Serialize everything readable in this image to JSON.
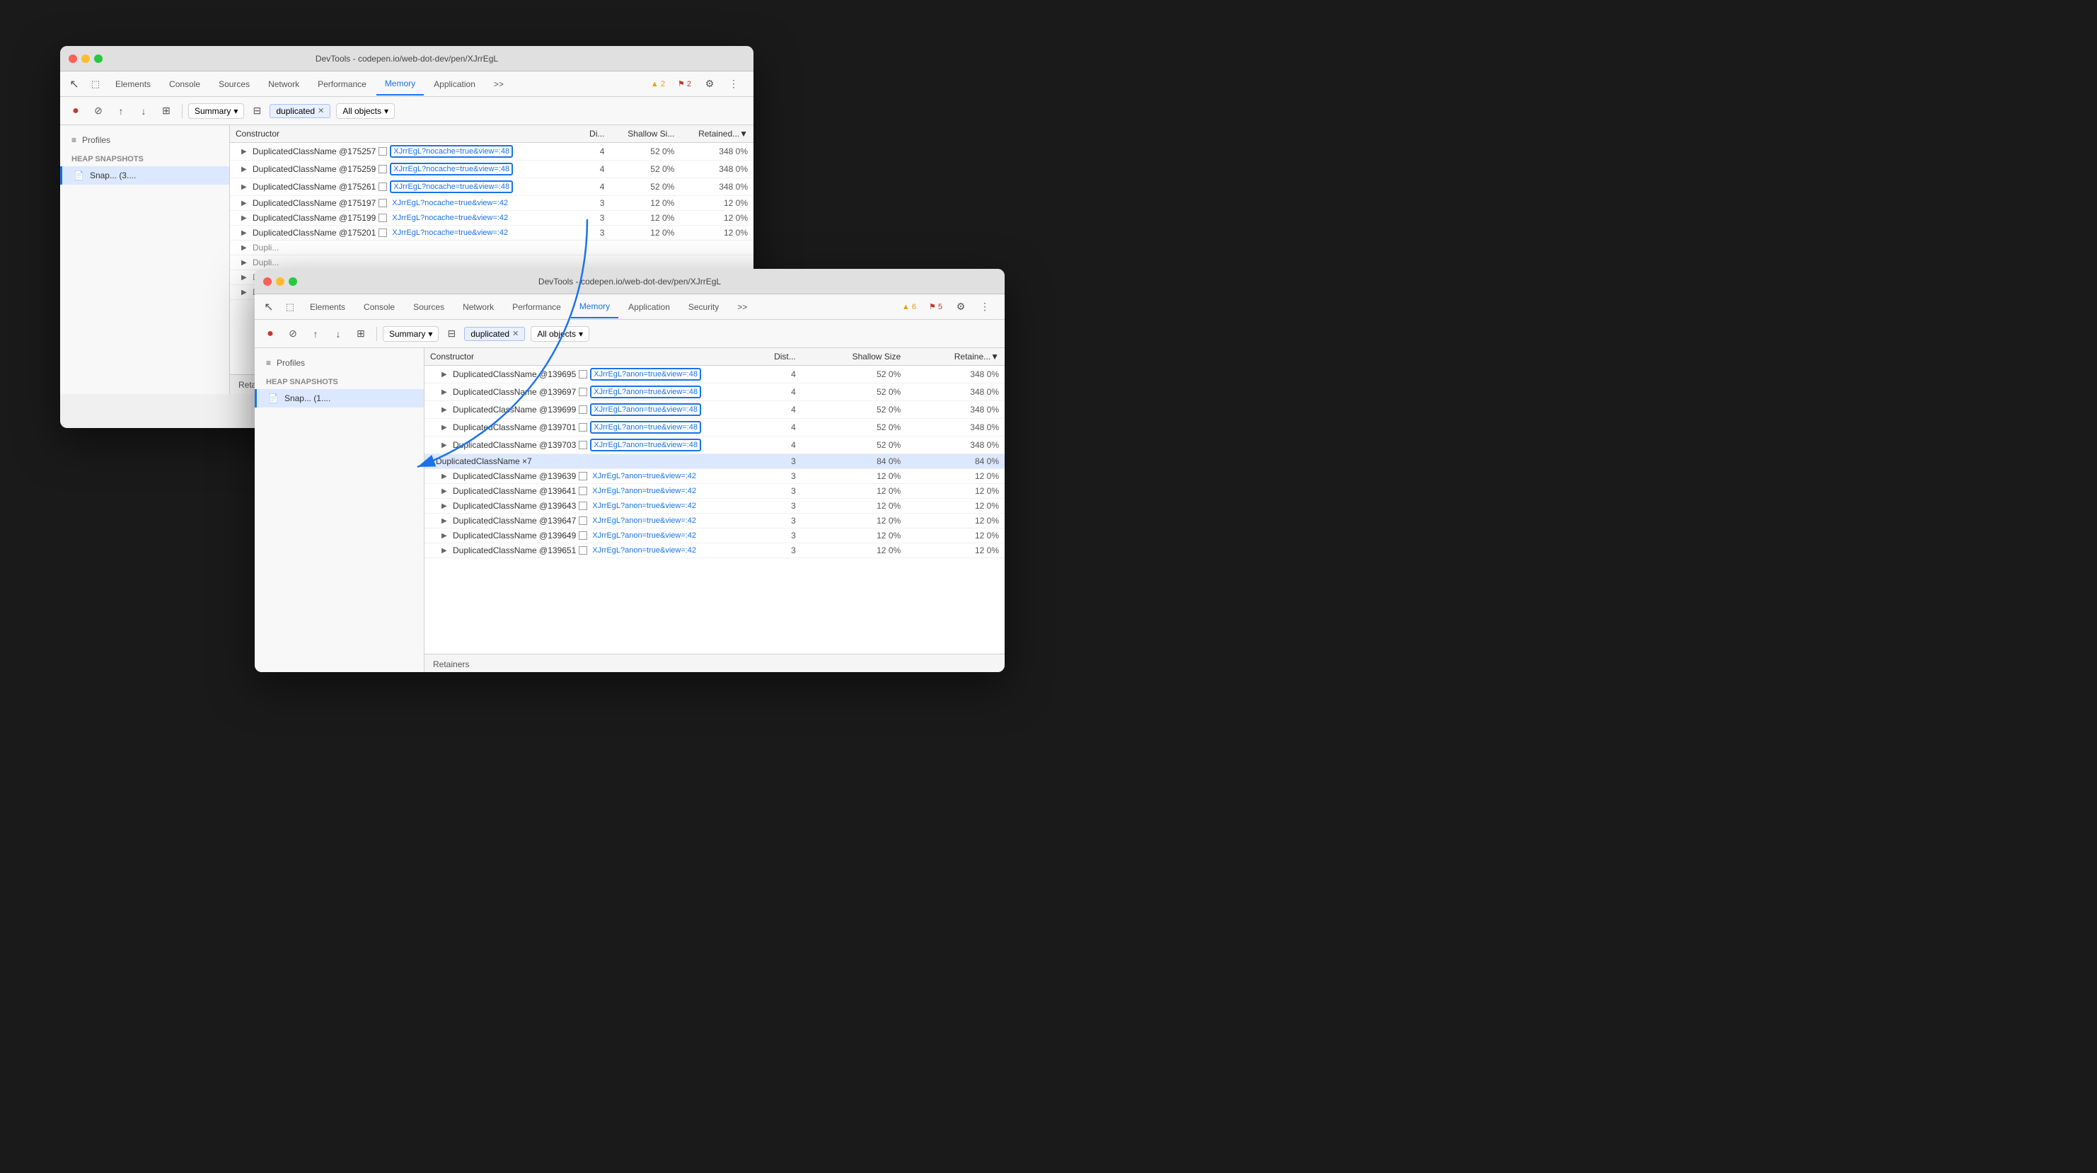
{
  "window1": {
    "title": "DevTools - codepen.io/web-dot-dev/pen/XJrrEgL",
    "tabs": [
      "Elements",
      "Console",
      "Sources",
      "Network",
      "Performance",
      "Memory",
      "Application",
      ">>"
    ],
    "active_tab": "Memory",
    "badges": [
      {
        "type": "warn",
        "count": "2"
      },
      {
        "type": "error",
        "count": "2"
      }
    ],
    "filter_label": "Summary",
    "filter_tag": "duplicated",
    "filter_all": "All objects",
    "table": {
      "headers": [
        "Constructor",
        "Di...",
        "Shallow Si...",
        "Retained...▼"
      ],
      "rows": [
        {
          "constructor": "DuplicatedClassName @175257",
          "link": "XJrrEgL?nocache=true&view=:48",
          "dist": "4",
          "shallow": "52",
          "sp": "0%",
          "retained": "348",
          "rp": "0%"
        },
        {
          "constructor": "DuplicatedClassName @175259",
          "link": "XJrrEgL?nocache=true&view=:48",
          "dist": "4",
          "shallow": "52",
          "sp": "0%",
          "retained": "348",
          "rp": "0%"
        },
        {
          "constructor": "DuplicatedClassName @175261",
          "link": "XJrrEgL?nocache=true&view=:48",
          "dist": "4",
          "shallow": "52",
          "sp": "0%",
          "retained": "348",
          "rp": "0%"
        },
        {
          "constructor": "DuplicatedClassName @175197",
          "link": "XJrrEgL?nocache=true&view=:42",
          "dist": "3",
          "shallow": "12",
          "sp": "0%",
          "retained": "12",
          "rp": "0%"
        },
        {
          "constructor": "DuplicatedClassName @175199",
          "link": "XJrrEgL?nocache=true&view=:42",
          "dist": "3",
          "shallow": "12",
          "sp": "0%",
          "retained": "12",
          "rp": "0%"
        },
        {
          "constructor": "DuplicatedClassName @175201",
          "link": "XJrrEgL?nocache=true&view=:42",
          "dist": "3",
          "shallow": "12",
          "sp": "0%",
          "retained": "12",
          "rp": "0%"
        },
        {
          "constructor": "Dupli...",
          "link": "",
          "dist": "",
          "shallow": "",
          "sp": "",
          "retained": "",
          "rp": ""
        },
        {
          "constructor": "Dupli...",
          "link": "",
          "dist": "",
          "shallow": "",
          "sp": "",
          "retained": "",
          "rp": ""
        },
        {
          "constructor": "Dupli...",
          "link": "",
          "dist": "",
          "shallow": "",
          "sp": "",
          "retained": "",
          "rp": ""
        },
        {
          "constructor": "Dupli...",
          "link": "",
          "dist": "",
          "shallow": "",
          "sp": "",
          "retained": "",
          "rp": ""
        }
      ]
    },
    "sidebar": {
      "profiles_label": "Profiles",
      "heap_snapshots_label": "Heap snapshots",
      "snapshot_label": "Snap... (3...."
    }
  },
  "window2": {
    "title": "DevTools - codepen.io/web-dot-dev/pen/XJrrEgL",
    "tabs": [
      "Elements",
      "Console",
      "Sources",
      "Network",
      "Performance",
      "Memory",
      "Application",
      "Security",
      ">>"
    ],
    "active_tab": "Memory",
    "badges": [
      {
        "type": "warn",
        "count": "6"
      },
      {
        "type": "error",
        "count": "5"
      }
    ],
    "filter_label": "Summary",
    "filter_tag": "duplicated",
    "filter_all": "All objects",
    "table": {
      "headers": [
        "Constructor",
        "Dist...",
        "Shallow Size",
        "Retaine...▼"
      ],
      "rows": [
        {
          "constructor": "DuplicatedClassName @139695",
          "link": "XJrrEgL?anon=true&view=:48",
          "dist": "4",
          "shallow": "52",
          "sp": "0%",
          "retained": "348",
          "rp": "0%",
          "indent": 1
        },
        {
          "constructor": "DuplicatedClassName @139697",
          "link": "XJrrEgL?anon=true&view=:48",
          "dist": "4",
          "shallow": "52",
          "sp": "0%",
          "retained": "348",
          "rp": "0%",
          "indent": 1
        },
        {
          "constructor": "DuplicatedClassName @139699",
          "link": "XJrrEgL?anon=true&view=:48",
          "dist": "4",
          "shallow": "52",
          "sp": "0%",
          "retained": "348",
          "rp": "0%",
          "indent": 1
        },
        {
          "constructor": "DuplicatedClassName @139701",
          "link": "XJrrEgL?anon=true&view=:48",
          "dist": "4",
          "shallow": "52",
          "sp": "0%",
          "retained": "348",
          "rp": "0%",
          "indent": 1
        },
        {
          "constructor": "DuplicatedClassName @139703",
          "link": "XJrrEgL?anon=true&view=:48",
          "dist": "4",
          "shallow": "52",
          "sp": "0%",
          "retained": "348",
          "rp": "0%",
          "indent": 1
        },
        {
          "constructor": "DuplicatedClassName ×7",
          "link": "",
          "dist": "3",
          "shallow": "84",
          "sp": "0%",
          "retained": "84",
          "rp": "0%",
          "indent": 0,
          "expanded": true,
          "highlight": true
        },
        {
          "constructor": "DuplicatedClassName @139639",
          "link": "XJrrEgL?anon=true&view=:42",
          "dist": "3",
          "shallow": "12",
          "sp": "0%",
          "retained": "12",
          "rp": "0%",
          "indent": 1
        },
        {
          "constructor": "DuplicatedClassName @139641",
          "link": "XJrrEgL?anon=true&view=:42",
          "dist": "3",
          "shallow": "12",
          "sp": "0%",
          "retained": "12",
          "rp": "0%",
          "indent": 1
        },
        {
          "constructor": "DuplicatedClassName @139643",
          "link": "XJrrEgL?anon=true&view=:42",
          "dist": "3",
          "shallow": "12",
          "sp": "0%",
          "retained": "12",
          "rp": "0%",
          "indent": 1
        },
        {
          "constructor": "DuplicatedClassName @139647",
          "link": "XJrrEgL?anon=true&view=:42",
          "dist": "3",
          "shallow": "12",
          "sp": "0%",
          "retained": "12",
          "rp": "0%",
          "indent": 1
        },
        {
          "constructor": "DuplicatedClassName @139649",
          "link": "XJrrEgL?anon=true&view=:42",
          "dist": "3",
          "shallow": "12",
          "sp": "0%",
          "retained": "12",
          "rp": "0%",
          "indent": 1
        },
        {
          "constructor": "DuplicatedClassName @139651",
          "link": "XJrrEgL?anon=true&view=:42",
          "dist": "3",
          "shallow": "12",
          "sp": "0%",
          "retained": "12",
          "rp": "0%",
          "indent": 1
        }
      ]
    },
    "sidebar": {
      "profiles_label": "Profiles",
      "heap_snapshots_label": "Heap snapshots",
      "snapshot_label": "Snap... (1...."
    }
  },
  "icons": {
    "cursor": "↖",
    "inspector": "⬚",
    "record": "●",
    "stop": "⊘",
    "upload": "↑",
    "download": "↓",
    "grid": "⊞",
    "filter": "≡",
    "gear": "⚙",
    "more": "⋮",
    "chevron": "▾",
    "warn": "▲",
    "flag": "⚑",
    "expand": "▶",
    "expanded": "▼",
    "file": "📄"
  }
}
